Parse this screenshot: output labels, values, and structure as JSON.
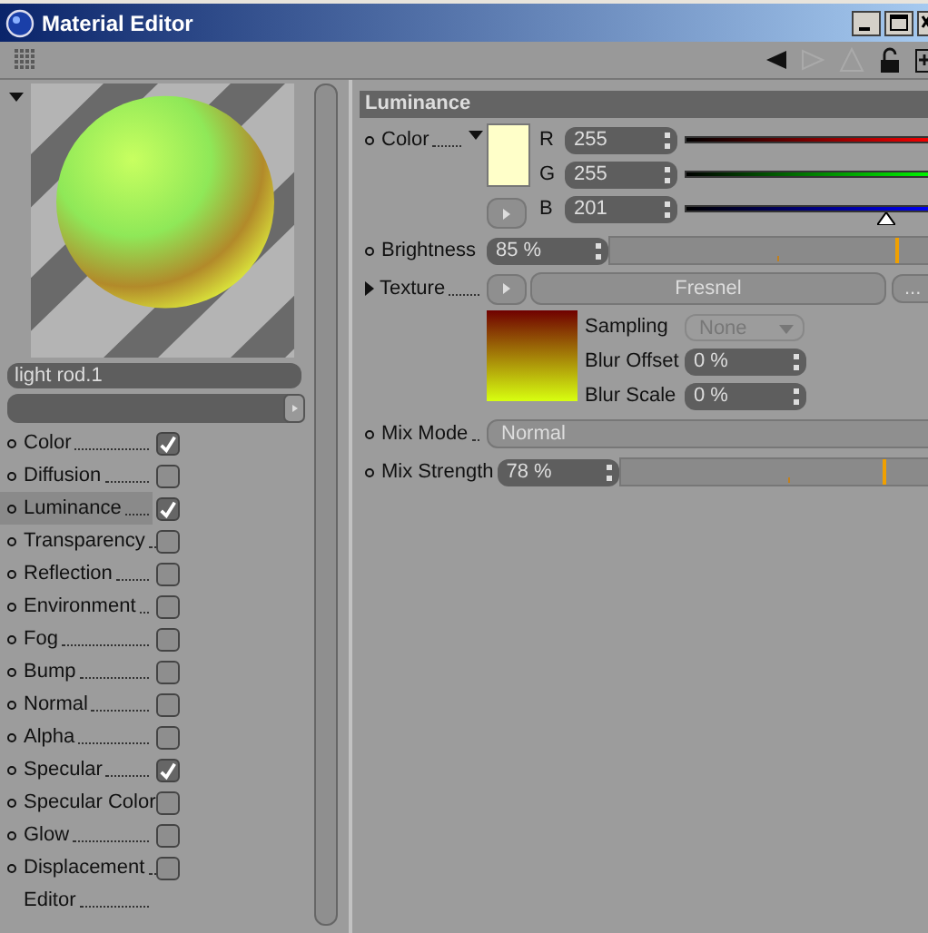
{
  "window": {
    "title": "Material Editor"
  },
  "material": {
    "name": "light rod.1"
  },
  "channels": [
    {
      "kind": "checkbox",
      "label": "Color",
      "checked": true,
      "selected": false
    },
    {
      "kind": "checkbox",
      "label": "Diffusion",
      "checked": false,
      "selected": false
    },
    {
      "kind": "checkbox",
      "label": "Luminance",
      "checked": true,
      "selected": true
    },
    {
      "kind": "checkbox",
      "label": "Transparency",
      "checked": false,
      "selected": false
    },
    {
      "kind": "checkbox",
      "label": "Reflection",
      "checked": false,
      "selected": false
    },
    {
      "kind": "checkbox",
      "label": "Environment",
      "checked": false,
      "selected": false
    },
    {
      "kind": "checkbox",
      "label": "Fog",
      "checked": false,
      "selected": false
    },
    {
      "kind": "checkbox",
      "label": "Bump",
      "checked": false,
      "selected": false
    },
    {
      "kind": "checkbox",
      "label": "Normal",
      "checked": false,
      "selected": false
    },
    {
      "kind": "checkbox",
      "label": "Alpha",
      "checked": false,
      "selected": false
    },
    {
      "kind": "checkbox",
      "label": "Specular",
      "checked": true,
      "selected": false
    },
    {
      "kind": "checkbox",
      "label": "Specular Color",
      "checked": false,
      "selected": false
    },
    {
      "kind": "checkbox",
      "label": "Glow",
      "checked": false,
      "selected": false
    },
    {
      "kind": "checkbox",
      "label": "Displacement",
      "checked": false,
      "selected": false
    },
    {
      "kind": "plain",
      "label": "Editor",
      "selected": false
    }
  ],
  "section": {
    "title": "Luminance",
    "color": {
      "label": "Color",
      "components": [
        {
          "label": "R",
          "value": "255"
        },
        {
          "label": "G",
          "value": "255"
        },
        {
          "label": "B",
          "value": "201",
          "level": 0.79
        }
      ]
    },
    "brightness": {
      "label": "Brightness",
      "value": "85 %",
      "level": 0.85
    },
    "texture": {
      "label": "Texture",
      "name": "Fresnel",
      "more": "...",
      "sampling": {
        "label": "Sampling",
        "value": "None",
        "disabled": true
      },
      "blur_offset": {
        "label": "Blur Offset",
        "value": "0 %"
      },
      "blur_scale": {
        "label": "Blur Scale",
        "value": "0 %"
      }
    },
    "mix_mode": {
      "label": "Mix Mode",
      "value": "Normal"
    },
    "mix_strength": {
      "label": "Mix Strength",
      "value": "78 %",
      "level": 0.78
    }
  }
}
